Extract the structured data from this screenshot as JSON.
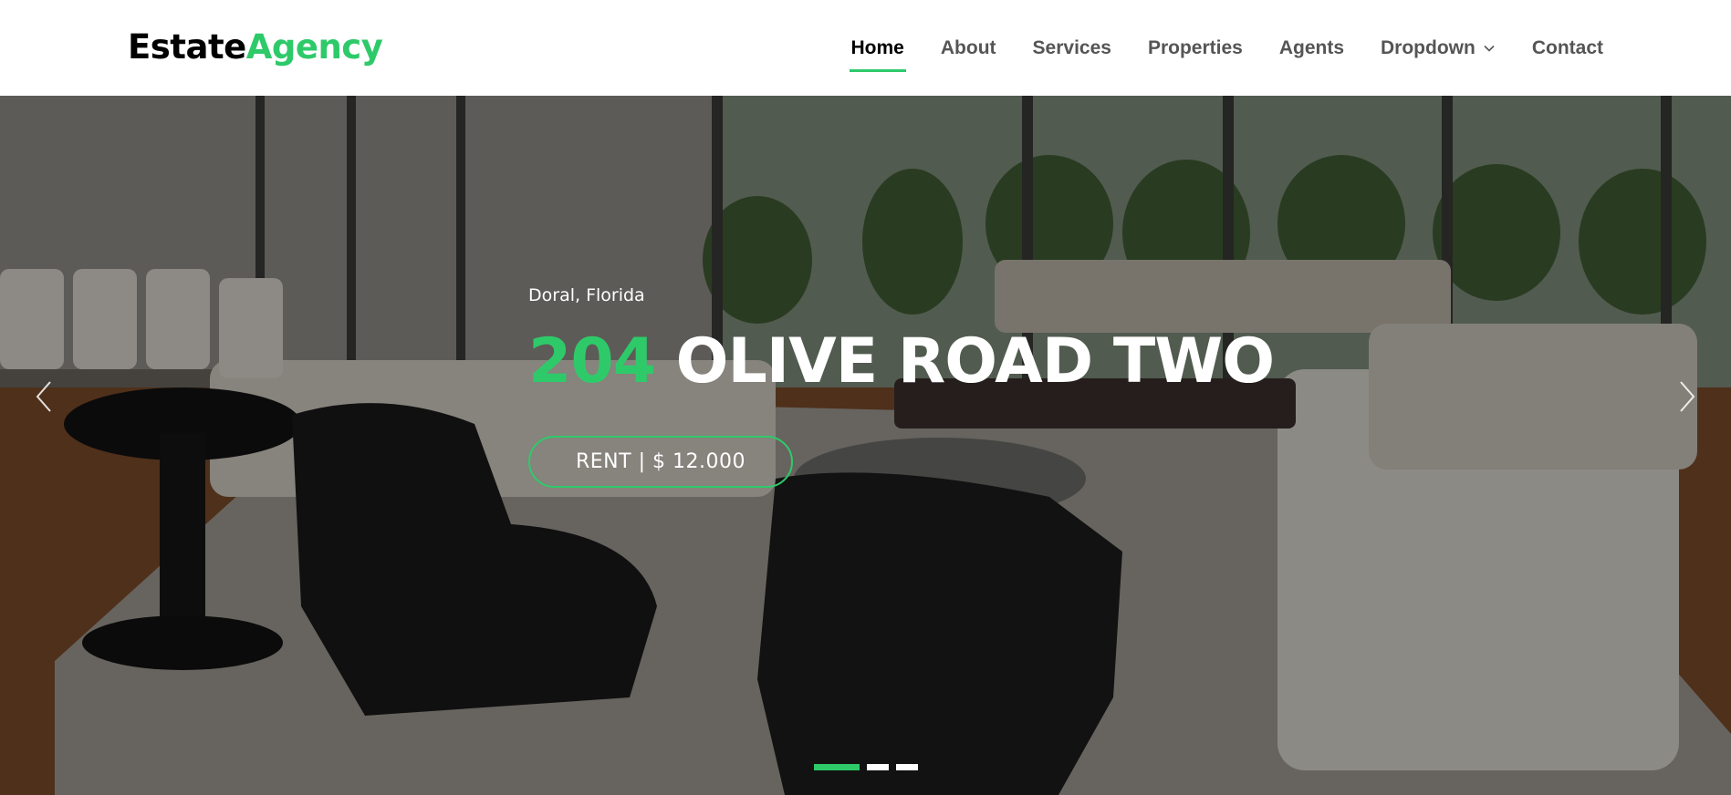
{
  "brand": {
    "name_part1": "Estate",
    "name_part2": "Agency",
    "accent_color": "#2eca6a"
  },
  "nav": {
    "items": [
      {
        "label": "Home",
        "active": true
      },
      {
        "label": "About"
      },
      {
        "label": "Services"
      },
      {
        "label": "Properties"
      },
      {
        "label": "Agents"
      },
      {
        "label": "Dropdown",
        "icon": "chevron-down-icon"
      },
      {
        "label": "Contact"
      }
    ]
  },
  "hero": {
    "location": "Doral, Florida",
    "title_number": "204",
    "title_rest": "OLIVE ROAD TWO",
    "cta_label": "RENT | $ 12.000",
    "prev_icon": "chevron-left-icon",
    "next_icon": "chevron-right-icon",
    "slides": {
      "count": 3,
      "active": 1
    }
  }
}
